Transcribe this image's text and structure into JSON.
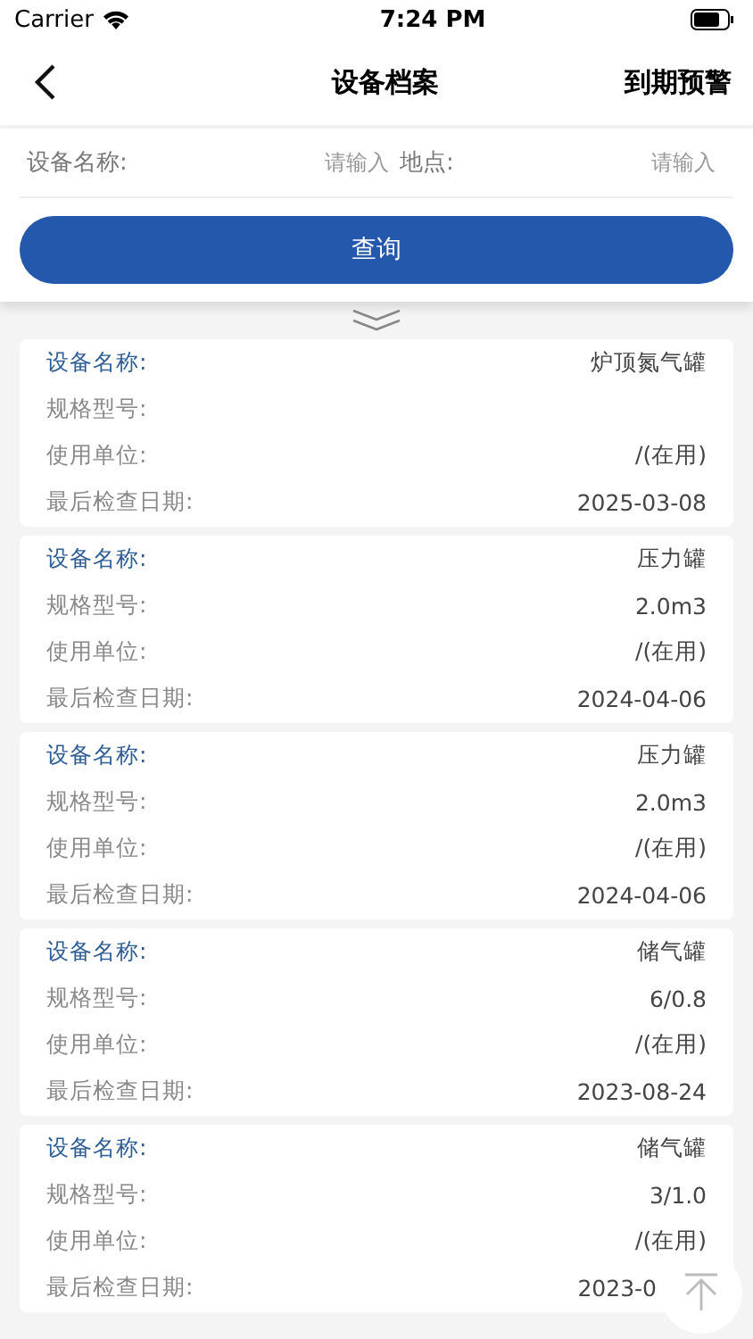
{
  "status_bar": {
    "carrier": "Carrier",
    "time": "7:24 PM"
  },
  "nav": {
    "title": "设备档案",
    "action": "到期预警"
  },
  "search": {
    "fields": [
      {
        "label": "设备名称:",
        "placeholder": "请输入"
      },
      {
        "label": "地点:",
        "placeholder": "请输入"
      }
    ],
    "button": "查询"
  },
  "cards": [
    {
      "fields": [
        {
          "kind": "name",
          "label": "设备名称:",
          "value": "炉顶氮气罐"
        },
        {
          "kind": "detail",
          "label": "规格型号:"
        },
        {
          "kind": "detail",
          "label": "使用单位:",
          "value": "/(在用)"
        },
        {
          "kind": "detail",
          "label": "最后检查日期:",
          "value": "2025-03-08"
        }
      ]
    },
    {
      "fields": [
        {
          "kind": "name",
          "label": "设备名称:",
          "value": "压力罐"
        },
        {
          "kind": "detail",
          "label": "规格型号:",
          "value": "2.0m3"
        },
        {
          "kind": "detail",
          "label": "使用单位:",
          "value": "/(在用)"
        },
        {
          "kind": "detail",
          "label": "最后检查日期:",
          "value": "2024-04-06"
        }
      ]
    },
    {
      "fields": [
        {
          "kind": "name",
          "label": "设备名称:",
          "value": "压力罐"
        },
        {
          "kind": "detail",
          "label": "规格型号:",
          "value": "2.0m3"
        },
        {
          "kind": "detail",
          "label": "使用单位:",
          "value": "/(在用)"
        },
        {
          "kind": "detail",
          "label": "最后检查日期:",
          "value": "2024-04-06"
        }
      ]
    },
    {
      "fields": [
        {
          "kind": "name",
          "label": "设备名称:",
          "value": "储气罐"
        },
        {
          "kind": "detail",
          "label": "规格型号:",
          "value": "6/0.8"
        },
        {
          "kind": "detail",
          "label": "使用单位:",
          "value": "/(在用)"
        },
        {
          "kind": "detail",
          "label": "最后检查日期:",
          "value": "2023-08-24"
        }
      ]
    },
    {
      "fields": [
        {
          "kind": "name",
          "label": "设备名称:",
          "value": "储气罐"
        },
        {
          "kind": "detail",
          "label": "规格型号:",
          "value": "3/1.0"
        },
        {
          "kind": "detail",
          "label": "使用单位:",
          "value": "/(在用)"
        },
        {
          "kind": "detail",
          "label": "最后检查日期:",
          "value": "2023-0"
        }
      ]
    }
  ]
}
